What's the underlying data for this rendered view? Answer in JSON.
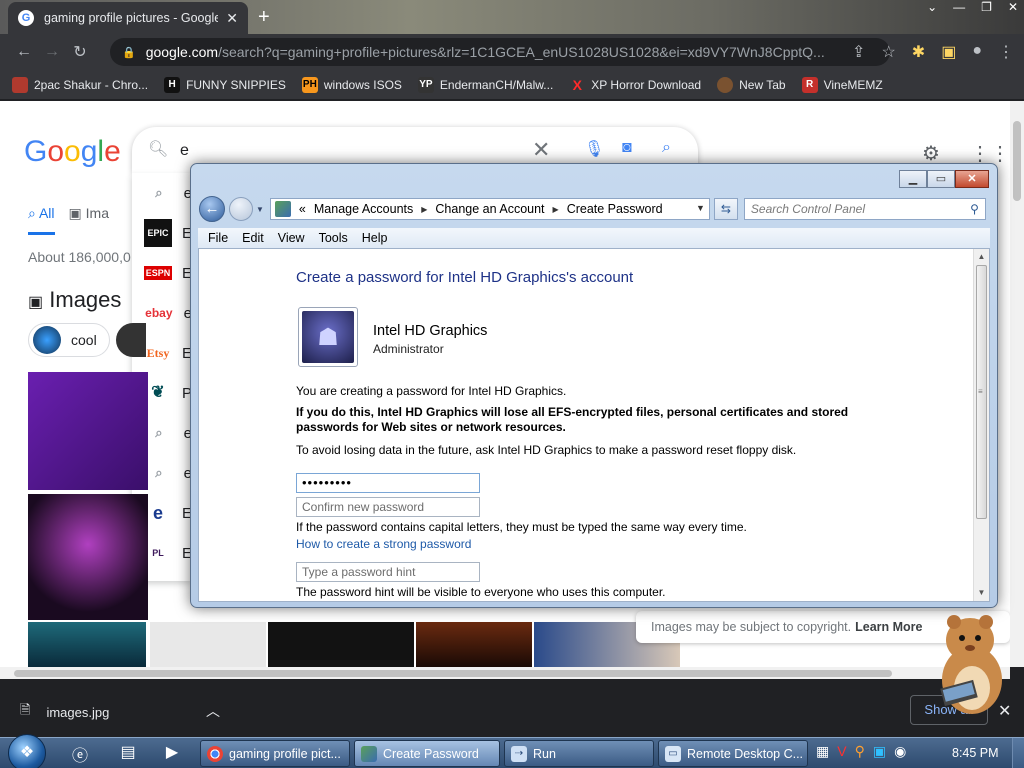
{
  "chrome": {
    "tab_title": "gaming profile pictures - Google",
    "url_host": "google.com",
    "url_path": "/search?q=gaming+profile+pictures&rlz=1C1GCEA_enUS1028US1028&ei=xd9VY7WnJ8CpptQ...",
    "bookmarks": [
      {
        "label": "2pac Shakur - Chro...",
        "icon": "2pac-icon",
        "color": "#b03a2e"
      },
      {
        "label": "FUNNY SNIPPIES",
        "icon": "H",
        "color": "#111111"
      },
      {
        "label": "windows ISOS",
        "icon": "PH",
        "color": "#f7971d"
      },
      {
        "label": "EndermanCH/Malw...",
        "icon": "YP",
        "color": "#333333"
      },
      {
        "label": "XP Horror Download",
        "icon": "X",
        "color": "#cc0000"
      },
      {
        "label": "New Tab",
        "icon": "newtab-icon",
        "color": "#7a5230"
      },
      {
        "label": "VineMEMZ",
        "icon": "R",
        "color": "#c4302b"
      }
    ]
  },
  "google": {
    "query": "e",
    "tabs": [
      "All",
      "Ima"
    ],
    "about": "About 186,000,0",
    "images_heading": "Images",
    "chip": "cool",
    "suggestions": [
      {
        "icon": "",
        "text": "e"
      },
      {
        "icon": "EPIC",
        "text": "E"
      },
      {
        "icon": "ESPN",
        "text": "E"
      },
      {
        "icon": "ebay",
        "text": "e"
      },
      {
        "icon": "Etsy",
        "text": "E"
      },
      {
        "icon": "eagles",
        "text": "P"
      },
      {
        "icon": "",
        "text": "e"
      },
      {
        "icon": "",
        "text": "e"
      },
      {
        "icon": "e",
        "text": "E"
      },
      {
        "icon": "PL",
        "text": "E"
      }
    ],
    "copyright": "Images may be subject to copyright.",
    "learn_more": "Learn More"
  },
  "downloads": {
    "file": "images.jpg",
    "show_all": "Show all"
  },
  "window": {
    "breadcrumb": [
      "Manage Accounts",
      "Change an Account",
      "Create Password"
    ],
    "search_placeholder": "Search Control Panel",
    "menu": [
      "File",
      "Edit",
      "View",
      "Tools",
      "Help"
    ],
    "heading": "Create a password for Intel HD Graphics's account",
    "user_name": "Intel HD Graphics",
    "user_role": "Administrator",
    "p1": "You are creating a password for Intel HD Graphics.",
    "warning": "If you do this, Intel HD Graphics will lose all EFS-encrypted files, personal certificates and stored passwords for Web sites or network resources.",
    "p2": "To avoid losing data in the future, ask Intel HD Graphics to make a password reset floppy disk.",
    "password_value": "•••••••••",
    "confirm_placeholder": "Confirm new password",
    "caps_note": "If the password contains capital letters, they must be typed the same way every time.",
    "strong_link": "How to create a strong password",
    "hint_placeholder": "Type a password hint",
    "hint_note": "The password hint will be visible to everyone who uses this computer."
  },
  "taskbar": {
    "buttons": [
      {
        "label": "gaming profile pict...",
        "icon": "chrome-icon",
        "active": false
      },
      {
        "label": "Create Password",
        "icon": "control-panel-icon",
        "active": true
      },
      {
        "label": "Run",
        "icon": "run-icon",
        "active": false
      },
      {
        "label": "Remote Desktop C...",
        "icon": "remote-desktop-icon",
        "active": false
      }
    ],
    "clock": "8:45 PM"
  }
}
